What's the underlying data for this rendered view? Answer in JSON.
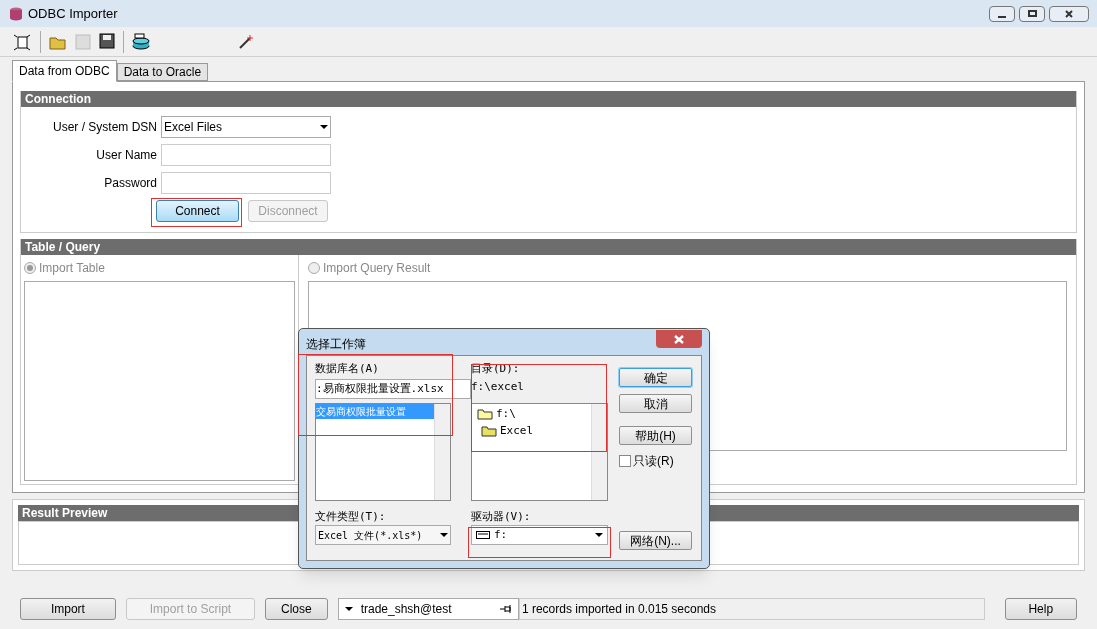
{
  "window": {
    "title": "ODBC Importer"
  },
  "tabs": [
    {
      "label": "Data from ODBC",
      "selected": true
    },
    {
      "label": "Data to Oracle",
      "selected": false
    }
  ],
  "connection": {
    "title": "Connection",
    "dsn_label": "User / System DSN",
    "dsn_value": "Excel Files",
    "user_label": "User Name",
    "password_label": "Password",
    "buttons": [
      {
        "label": "Connect",
        "disabled": false,
        "focused": true
      },
      {
        "label": "Disconnect",
        "disabled": true,
        "focused": false
      }
    ]
  },
  "table_query": {
    "title": "Table / Query",
    "options": [
      {
        "label": "Import Table",
        "selected": true
      },
      {
        "label": "Import Query Result",
        "selected": false
      }
    ]
  },
  "result_preview": {
    "title": "Result Preview"
  },
  "bottom": {
    "buttons": [
      {
        "label": "Import",
        "disabled": false
      },
      {
        "label": "Import to Script",
        "disabled": true
      },
      {
        "label": "Close",
        "disabled": false
      }
    ],
    "connection": "trade_shsh@test",
    "status": "1 records imported in 0.015 seconds",
    "help": "Help"
  },
  "dialog": {
    "title": "选择工作簿",
    "db_label": "数据库名(A)",
    "db_value": ":易商权限批量设置.xlsx",
    "db_items": [
      {
        "label": "交易商权限批量设置",
        "selected": true
      }
    ],
    "dir_label": "目录(D):",
    "dir_path": "f:\\excel",
    "dir_tree": [
      {
        "label": "f:\\",
        "children": [
          {
            "label": "Excel"
          }
        ]
      }
    ],
    "filetype_label": "文件类型(T):",
    "filetype_value": "Excel 文件(*.xls*)",
    "drive_label": "驱动器(V):",
    "drive_value": "f:",
    "buttons": [
      {
        "label": "确定",
        "default": true
      },
      {
        "label": "取消",
        "default": false
      },
      {
        "label": "帮助(H)",
        "default": false
      }
    ],
    "readonly": {
      "label": "只读(R)",
      "checked": false
    },
    "network": "网络(N)..."
  }
}
